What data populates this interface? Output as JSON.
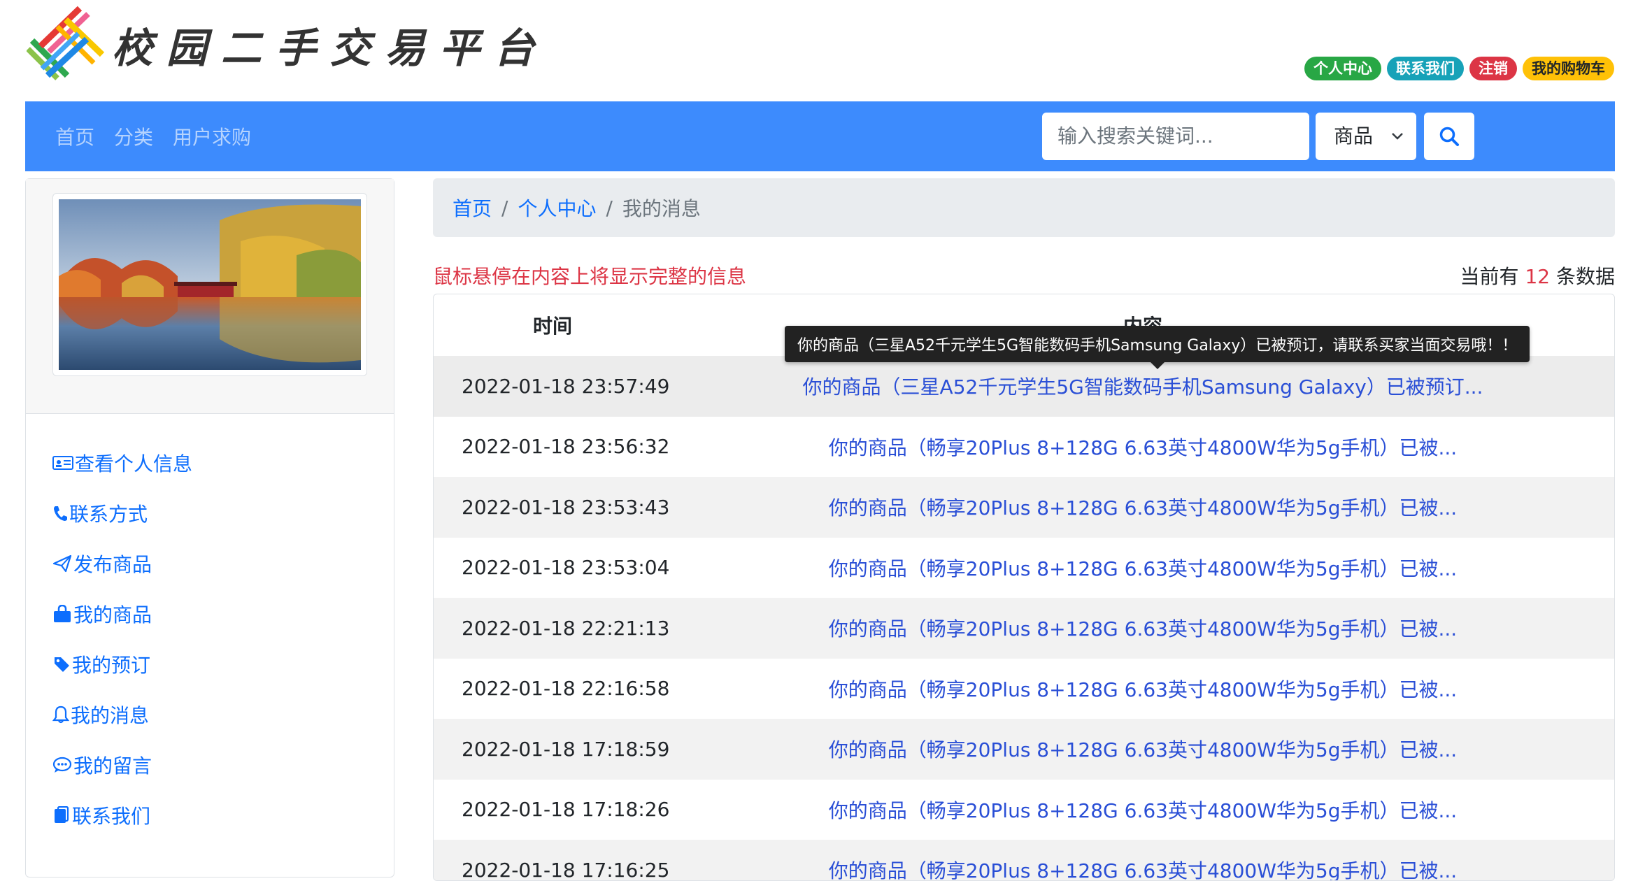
{
  "header": {
    "brand": "校园二手交易平台",
    "badges": [
      {
        "label": "个人中心",
        "variant": "green"
      },
      {
        "label": "联系我们",
        "variant": "teal"
      },
      {
        "label": "注销",
        "variant": "red"
      },
      {
        "label": "我的购物车",
        "variant": "yellow"
      }
    ]
  },
  "navbar": {
    "links": [
      "首页",
      "分类",
      "用户求购"
    ],
    "search_placeholder": "输入搜索关键词...",
    "search_type": "商品",
    "search_icon": "search-icon"
  },
  "sidebar": {
    "image_alt": "landscape-photo",
    "menu": [
      {
        "label": "查看个人信息",
        "icon": "id-card-icon"
      },
      {
        "label": "联系方式",
        "icon": "telephone-icon"
      },
      {
        "label": "发布商品",
        "icon": "send-icon"
      },
      {
        "label": "我的商品",
        "icon": "bag-icon"
      },
      {
        "label": "我的预订",
        "icon": "tag-icon"
      },
      {
        "label": "我的消息",
        "icon": "bell-icon"
      },
      {
        "label": "我的留言",
        "icon": "chat-icon"
      },
      {
        "label": "联系我们",
        "icon": "clipboard-icon"
      }
    ]
  },
  "breadcrumb": [
    "首页",
    "个人中心",
    "我的消息"
  ],
  "hint": "鼠标悬停在内容上将显示完整的信息",
  "count": {
    "prefix": "当前有",
    "value": "12",
    "suffix": "条数据"
  },
  "table": {
    "headers": {
      "time": "时间",
      "content": "内容"
    },
    "rows": [
      {
        "time": "2022-01-18 23:57:49",
        "content": "你的商品（三星A52千元学生5G智能数码手机Samsung Galaxy）已被预订..."
      },
      {
        "time": "2022-01-18 23:56:32",
        "content": "你的商品（畅享20Plus 8+128G 6.63英寸4800W华为5g手机）已被..."
      },
      {
        "time": "2022-01-18 23:53:43",
        "content": "你的商品（畅享20Plus 8+128G 6.63英寸4800W华为5g手机）已被..."
      },
      {
        "time": "2022-01-18 23:53:04",
        "content": "你的商品（畅享20Plus 8+128G 6.63英寸4800W华为5g手机）已被..."
      },
      {
        "time": "2022-01-18 22:21:13",
        "content": "你的商品（畅享20Plus 8+128G 6.63英寸4800W华为5g手机）已被..."
      },
      {
        "time": "2022-01-18 22:16:58",
        "content": "你的商品（畅享20Plus 8+128G 6.63英寸4800W华为5g手机）已被..."
      },
      {
        "time": "2022-01-18 17:18:59",
        "content": "你的商品（畅享20Plus 8+128G 6.63英寸4800W华为5g手机）已被..."
      },
      {
        "time": "2022-01-18 17:18:26",
        "content": "你的商品（畅享20Plus 8+128G 6.63英寸4800W华为5g手机）已被..."
      },
      {
        "time": "2022-01-18 17:16:25",
        "content": "你的商品（畅享20Plus 8+128G 6.63英寸4800W华为5g手机）已被..."
      }
    ]
  },
  "tooltip": "你的商品（三星A52千元学生5G智能数码手机Samsung Galaxy）已被预订，请联系买家当面交易哦！！"
}
